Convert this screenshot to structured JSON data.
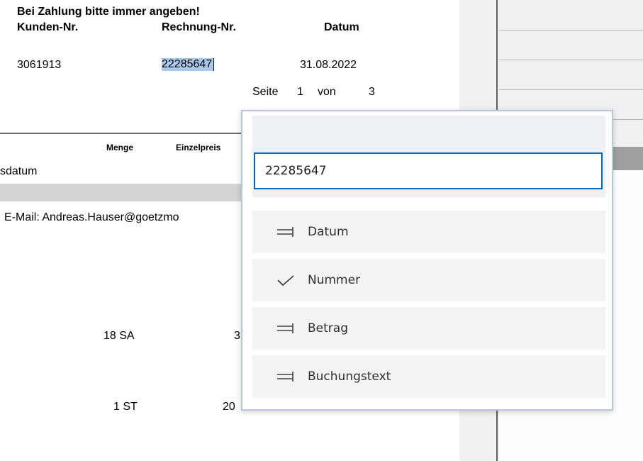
{
  "document": {
    "payment_note": "Bei Zahlung bitte immer angeben!",
    "header": {
      "customer_label": "Kunden-Nr.",
      "invoice_label": "Rechnung-Nr.",
      "date_label": "Datum",
      "customer_value": "3061913",
      "invoice_value": "22285647",
      "date_value": "31.08.2022"
    },
    "page": {
      "label": "Seite",
      "current": "1",
      "of_label": "von",
      "total": "3"
    },
    "table": {
      "col_quantity": "Menge",
      "col_unit_price": "Einzelpreis",
      "row_date_label": "sdatum",
      "email_text": "E-Mail: Andreas.Hauser@goetzmo",
      "rows": [
        {
          "quantity": "18 SA",
          "price": "3"
        },
        {
          "quantity": "1 ST",
          "price": "20"
        }
      ]
    }
  },
  "popup": {
    "input_value": "22285647",
    "options": [
      {
        "label": "Datum",
        "icon": "assign-arrows-icon"
      },
      {
        "label": "Nummer",
        "icon": "checkmark-icon"
      },
      {
        "label": "Betrag",
        "icon": "assign-arrows-icon"
      },
      {
        "label": "Buchungstext",
        "icon": "assign-arrows-icon"
      }
    ]
  },
  "colors": {
    "accent": "#0067c0",
    "selection": "#a9c8ec",
    "popup_border": "#b8c6d9"
  }
}
